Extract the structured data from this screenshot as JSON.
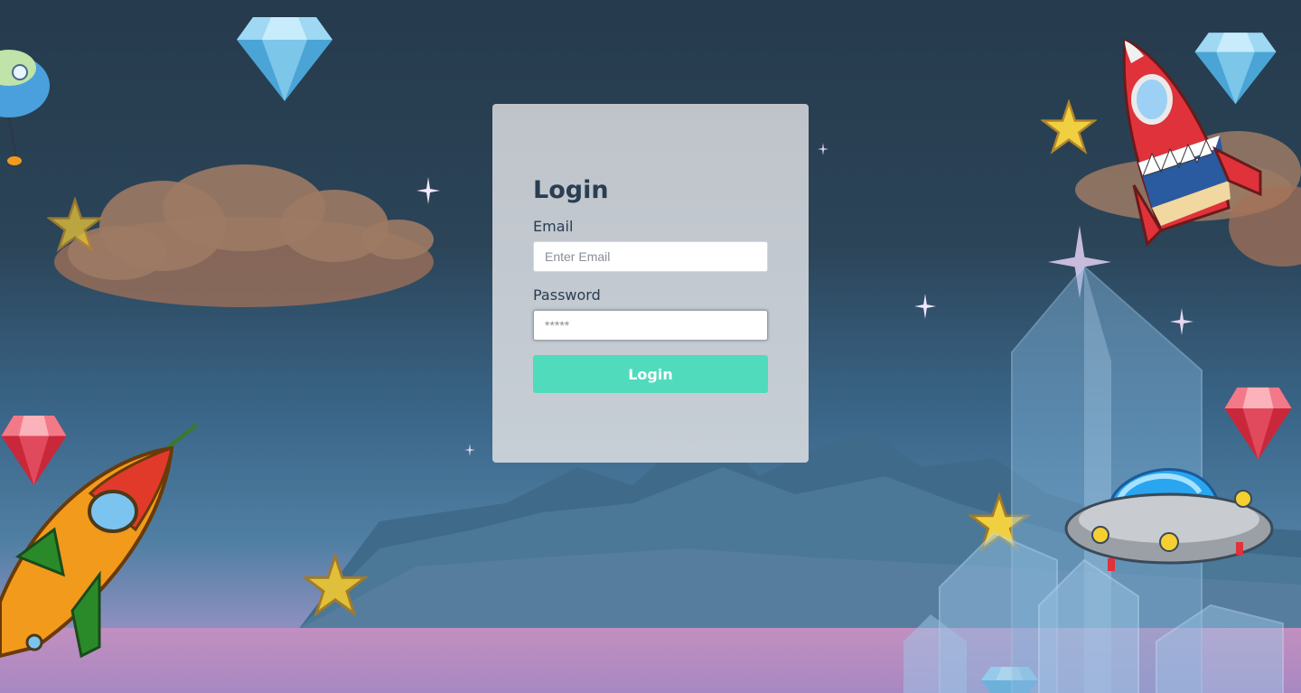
{
  "login": {
    "title": "Login",
    "email_label": "Email",
    "email_placeholder": "Enter Email",
    "password_label": "Password",
    "password_placeholder": "*****",
    "button_label": "Login"
  },
  "colors": {
    "card_bg": "#c2c8ce",
    "accent_button": "#50dbbc",
    "title_text": "#2a3d52",
    "sky_top": "#263b4d",
    "ground": "#b08cbe"
  },
  "decorations": {
    "icons": [
      "diamond-icon",
      "ruby-icon",
      "star-icon",
      "rocket-icon",
      "ufo-icon",
      "cloud-icon",
      "crystal-icon",
      "sparkle-icon"
    ]
  }
}
